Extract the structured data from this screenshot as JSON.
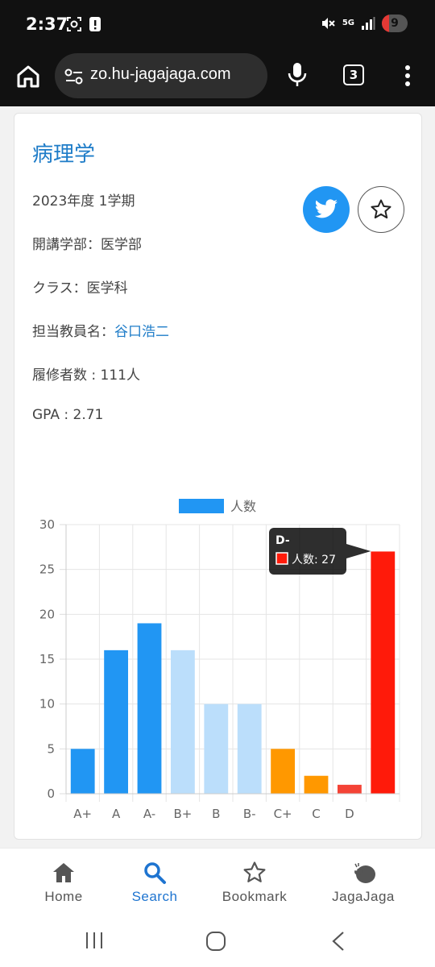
{
  "status": {
    "time": "2:37",
    "battery": "9",
    "net": "5G"
  },
  "browser": {
    "url": "zo.hu-jagajaga.com",
    "tab_count": "3"
  },
  "course": {
    "title": "病理学",
    "term": "2023年度 1学期",
    "faculty_label": "開講学部：",
    "faculty": "医学部",
    "class_label": "クラス：",
    "class": "医学科",
    "teacher_label": "担当教員名：",
    "teacher": "谷口浩二",
    "enrollment": "履修者数 : 111人",
    "gpa": "GPA : 2.71"
  },
  "colors": {
    "accent": "#1e74d0",
    "twitter": "#2196f3",
    "bar_dark_blue": "#2196f3",
    "bar_light_blue": "#bbdefb",
    "bar_orange": "#ff9800",
    "bar_light_red": "#f44336",
    "bar_red": "#ff1a0a"
  },
  "chart_data": {
    "type": "bar",
    "categories": [
      "A+",
      "A",
      "A-",
      "B+",
      "B",
      "B-",
      "C+",
      "C",
      "D",
      "D-"
    ],
    "visible_category_labels": [
      "A+",
      "A",
      "A-",
      "B+",
      "B",
      "B-",
      "C+",
      "C",
      "D"
    ],
    "series": [
      {
        "name": "人数",
        "values": [
          5,
          16,
          19,
          16,
          10,
          10,
          5,
          2,
          1,
          27
        ]
      }
    ],
    "bar_colors": [
      "#2196f3",
      "#2196f3",
      "#2196f3",
      "#bbdefb",
      "#bbdefb",
      "#bbdefb",
      "#ff9800",
      "#ff9800",
      "#f44336",
      "#ff1a0a"
    ],
    "ylim": [
      0,
      30
    ],
    "yticks": [
      0,
      5,
      10,
      15,
      20,
      25,
      30
    ],
    "grid": true,
    "legend": "top",
    "tooltip": {
      "title": "D-",
      "label": "人数: 27"
    }
  },
  "bottom_nav": [
    {
      "label": "Home",
      "icon": "home-icon",
      "active": false
    },
    {
      "label": "Search",
      "icon": "search-icon",
      "active": true
    },
    {
      "label": "Bookmark",
      "icon": "star-outline-icon",
      "active": false
    },
    {
      "label": "JagaJaga",
      "icon": "jagajaga-logo-icon",
      "active": false
    }
  ]
}
